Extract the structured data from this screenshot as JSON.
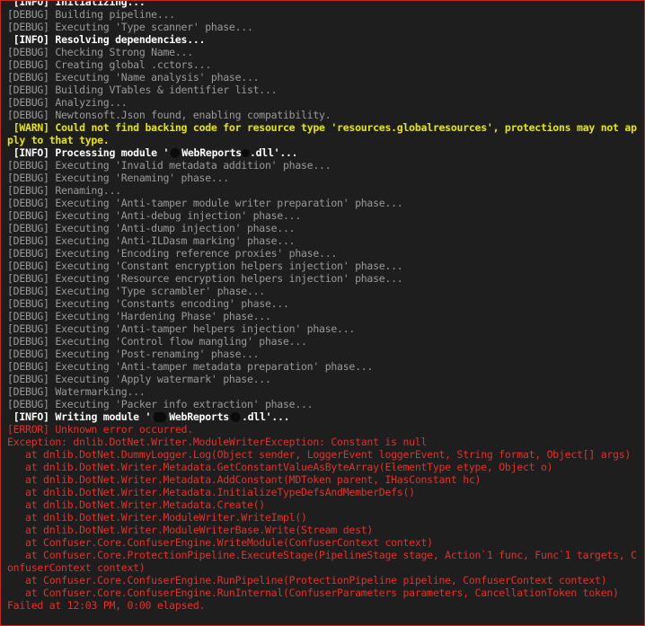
{
  "window": {
    "border_color": "#c42b1c",
    "background": "#1e1e1e"
  },
  "colors": {
    "debug": "#9a9a9a",
    "info": "#ffffff",
    "warn": "#e6e600",
    "error": "#e5302a"
  },
  "log": {
    "lines": [
      {
        "level": "info",
        "text": " [INFO] Initializing..."
      },
      {
        "level": "debug",
        "text": "[DEBUG] Building pipeline..."
      },
      {
        "level": "debug",
        "text": "[DEBUG] Executing 'Type scanner' phase..."
      },
      {
        "level": "info",
        "text": " [INFO] Resolving dependencies..."
      },
      {
        "level": "debug",
        "text": "[DEBUG] Checking Strong Name..."
      },
      {
        "level": "debug",
        "text": "[DEBUG] Creating global .cctors..."
      },
      {
        "level": "debug",
        "text": "[DEBUG] Executing 'Name analysis' phase..."
      },
      {
        "level": "debug",
        "text": "[DEBUG] Building VTables & identifier list..."
      },
      {
        "level": "debug",
        "text": "[DEBUG] Analyzing..."
      },
      {
        "level": "debug",
        "text": "[DEBUG] Newtonsoft.Json found, enabling compatibility."
      },
      {
        "level": "warn",
        "text": " [WARN] Could not find backing code for resource type 'resources.globalresources', protections may not apply to that type."
      },
      {
        "level": "info",
        "text": " [INFO] Processing module '",
        "redact1": "w1",
        "mid": "WebReports",
        "redact2": "w3",
        "tail": ".dll'..."
      },
      {
        "level": "debug",
        "text": "[DEBUG] Executing 'Invalid metadata addition' phase..."
      },
      {
        "level": "debug",
        "text": "[DEBUG] Executing 'Renaming' phase..."
      },
      {
        "level": "debug",
        "text": "[DEBUG] Renaming..."
      },
      {
        "level": "debug",
        "text": "[DEBUG] Executing 'Anti-tamper module writer preparation' phase..."
      },
      {
        "level": "debug",
        "text": "[DEBUG] Executing 'Anti-debug injection' phase..."
      },
      {
        "level": "debug",
        "text": "[DEBUG] Executing 'Anti-dump injection' phase..."
      },
      {
        "level": "debug",
        "text": "[DEBUG] Executing 'Anti-ILDasm marking' phase..."
      },
      {
        "level": "debug",
        "text": "[DEBUG] Executing 'Encoding reference proxies' phase..."
      },
      {
        "level": "debug",
        "text": "[DEBUG] Executing 'Constant encryption helpers injection' phase..."
      },
      {
        "level": "debug",
        "text": "[DEBUG] Executing 'Resource encryption helpers injection' phase..."
      },
      {
        "level": "debug",
        "text": "[DEBUG] Executing 'Type scrambler' phase..."
      },
      {
        "level": "debug",
        "text": "[DEBUG] Executing 'Constants encoding' phase..."
      },
      {
        "level": "debug",
        "text": "[DEBUG] Executing 'Hardening Phase' phase..."
      },
      {
        "level": "debug",
        "text": "[DEBUG] Executing 'Anti-tamper helpers injection' phase..."
      },
      {
        "level": "debug",
        "text": "[DEBUG] Executing 'Control flow mangling' phase..."
      },
      {
        "level": "debug",
        "text": "[DEBUG] Executing 'Post-renaming' phase..."
      },
      {
        "level": "debug",
        "text": "[DEBUG] Executing 'Anti-tamper metadata preparation' phase..."
      },
      {
        "level": "debug",
        "text": "[DEBUG] Executing 'Apply watermark' phase..."
      },
      {
        "level": "debug",
        "text": "[DEBUG] Watermarking..."
      },
      {
        "level": "debug",
        "text": "[DEBUG] Executing 'Packer info extraction' phase..."
      },
      {
        "level": "info",
        "text": " [INFO] Writing module '",
        "redact1": "w2",
        "mid": "WebReports",
        "redact2": "w1",
        "tail": ".dll'..."
      },
      {
        "level": "error",
        "text": "[ERROR] Unknown error occurred."
      },
      {
        "level": "error",
        "text": "Exception: dnlib.DotNet.Writer.ModuleWriterException: Constant is null"
      },
      {
        "level": "error",
        "text": "   at dnlib.DotNet.DummyLogger.Log(Object sender, LoggerEvent loggerEvent, String format, Object[] args)"
      },
      {
        "level": "error",
        "text": "   at dnlib.DotNet.Writer.Metadata.GetConstantValueAsByteArray(ElementType etype, Object o)"
      },
      {
        "level": "error",
        "text": "   at dnlib.DotNet.Writer.Metadata.AddConstant(MDToken parent, IHasConstant hc)"
      },
      {
        "level": "error",
        "text": "   at dnlib.DotNet.Writer.Metadata.InitializeTypeDefsAndMemberDefs()"
      },
      {
        "level": "error",
        "text": "   at dnlib.DotNet.Writer.Metadata.Create()"
      },
      {
        "level": "error",
        "text": "   at dnlib.DotNet.Writer.ModuleWriter.WriteImpl()"
      },
      {
        "level": "error",
        "text": "   at dnlib.DotNet.Writer.ModuleWriterBase.Write(Stream dest)"
      },
      {
        "level": "error",
        "text": "   at Confuser.Core.ConfuserEngine.WriteModule(ConfuserContext context)"
      },
      {
        "level": "error",
        "text": "   at Confuser.Core.ProtectionPipeline.ExecuteStage(PipelineStage stage, Action`1 func, Func`1 targets, ConfuserContext context)"
      },
      {
        "level": "error",
        "text": "   at Confuser.Core.ConfuserEngine.RunPipeline(ProtectionPipeline pipeline, ConfuserContext context)"
      },
      {
        "level": "error",
        "text": "   at Confuser.Core.ConfuserEngine.RunInternal(ConfuserParameters parameters, CancellationToken token)"
      },
      {
        "level": "error",
        "text": "Failed at 12:03 PM, 0:00 elapsed."
      }
    ]
  }
}
